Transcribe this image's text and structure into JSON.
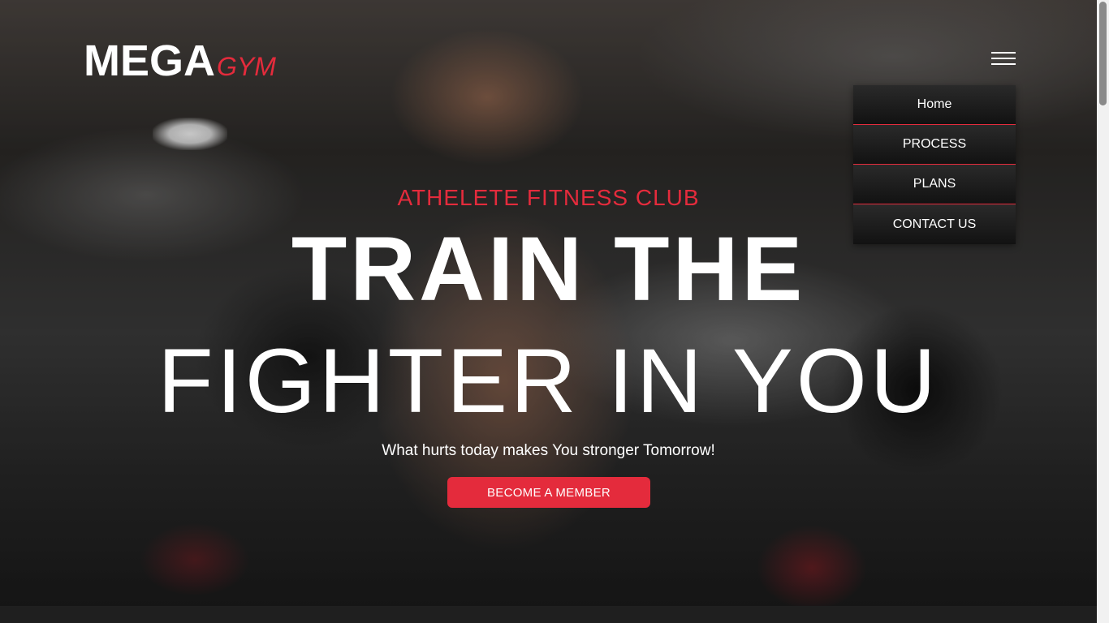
{
  "brand": {
    "name_main": "MEGA",
    "name_accent": "GYM"
  },
  "nav": {
    "menu_icon": "hamburger-menu-icon",
    "items": [
      {
        "label": "Home"
      },
      {
        "label": "PROCESS"
      },
      {
        "label": "PLANS"
      },
      {
        "label": "CONTACT US"
      }
    ]
  },
  "hero": {
    "tagline": "ATHELETE FITNESS CLUB",
    "headline_line1": "TRAIN THE",
    "headline_line2": "FIGHTER IN YOU",
    "subtitle": "What hurts today makes You stronger Tomorrow!",
    "cta_label": "BECOME A MEMBER"
  },
  "colors": {
    "accent": "#e42b3c",
    "text": "#ffffff",
    "menu_bg": "#141414"
  }
}
